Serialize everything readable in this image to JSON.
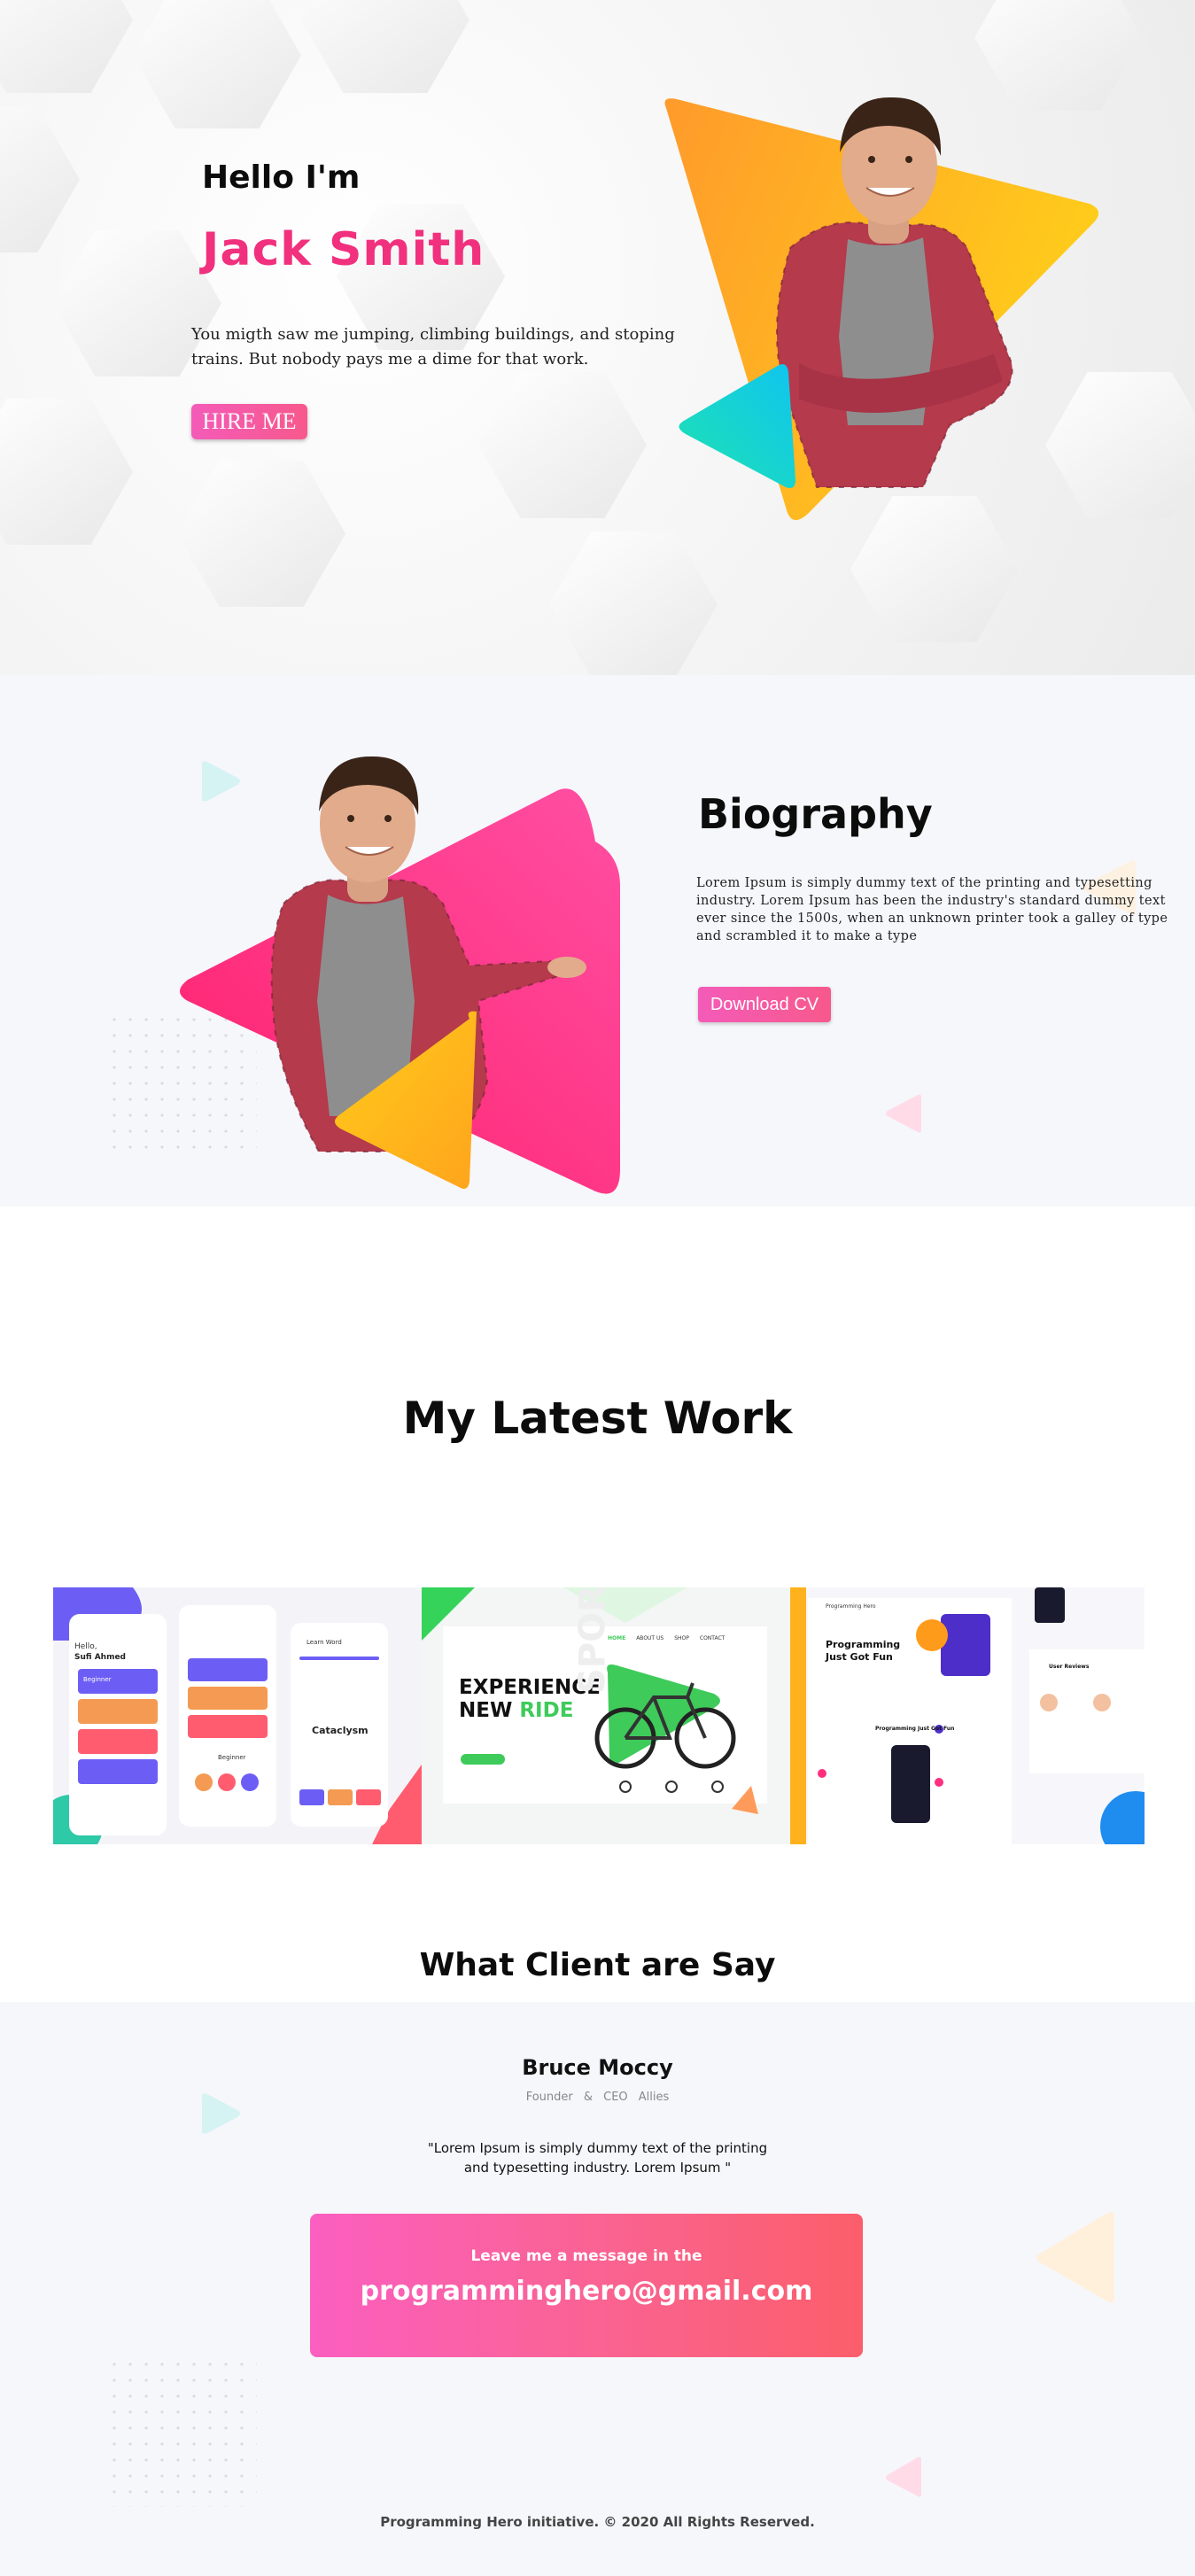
{
  "hero": {
    "greeting": "Hello I'm",
    "name": "Jack Smith",
    "description": "You migth saw me jumping, climbing buildings, and stoping trains. But nobody pays me a dime for that work.",
    "hire_label": "HIRE ME"
  },
  "bio": {
    "title": "Biography",
    "text": "Lorem Ipsum is simply dummy text of the printing and typesetting industry. Lorem Ipsum has been the industry's standard dummy text ever since the 1500s, when an unknown printer took a galley of type and scrambled it to make a type",
    "cv_label": "Download CV"
  },
  "work": {
    "title": "My Latest Work",
    "cards": [
      {
        "greeting": "Hello,",
        "user": "Sufi Ahmed",
        "level": "Beginner",
        "quiz_title": "Learn Word",
        "quiz_word": "Cataclysm",
        "footer_level": "Beginner"
      },
      {
        "headline_1": "EXPERIENCE",
        "headline_2a": "NEW ",
        "headline_2b": "RIDE",
        "side": "SPORT",
        "nav": [
          "HOME",
          "ABOUT US",
          "SHOP",
          "CONTACT"
        ]
      },
      {
        "brand": "Programming Hero",
        "headline": "Programming Just Got Fun",
        "section": "Programming Just Got Fun",
        "reviews": "User Reviews"
      }
    ]
  },
  "clients": {
    "title": "What Client are Say",
    "name": "Bruce Moccy",
    "role": "Founder & CEO Allies",
    "quote": "\"Lorem Ipsum is simply dummy text of the printing and typesetting industry. Lorem Ipsum \""
  },
  "contact": {
    "lead": "Leave me a message in the",
    "email": "programminghero@gmail.com"
  },
  "footer": {
    "text": "Programming Hero initiative. © 2020 All Rights Reserved."
  },
  "colors": {
    "accent_pink": "#f1307e",
    "button_pink": "#f45bb8",
    "orange": "#ffa31a",
    "teal": "#16d9c0",
    "band": "#f6f7fb"
  }
}
